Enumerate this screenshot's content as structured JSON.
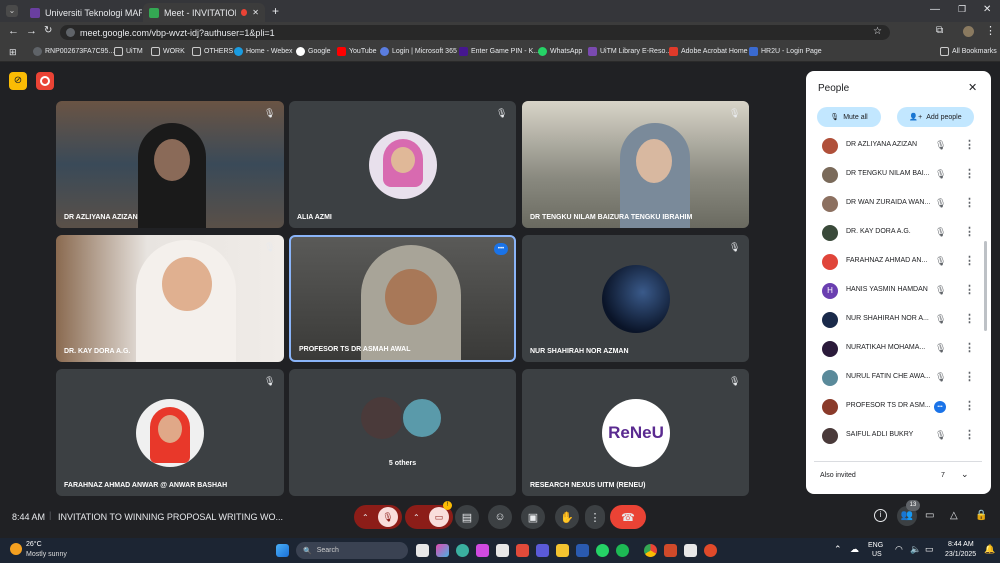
{
  "browser": {
    "tabs": [
      {
        "label": "Universiti Teknologi MARA - Ca",
        "active": false
      },
      {
        "label": "Meet - INVITATION TO WIN",
        "active": true
      }
    ],
    "new_tab": "+",
    "url": "meet.google.com/vbp-wvzt-idj?authuser=1&pli=1",
    "bookmarks": [
      "RNP002673FA7C95...",
      "UiTM",
      "WORK",
      "OTHERS",
      "Home - Webex",
      "Google",
      "YouTube",
      "Login | Microsoft 365",
      "Enter Game PIN - K...",
      "WhatsApp",
      "UiTM Library E-Reso...",
      "Adobe Acrobat Home",
      "HR2U - Login Page"
    ],
    "all_bookmarks": "All Bookmarks"
  },
  "tiles": [
    {
      "name": "DR AZLIYANA AZIZAN"
    },
    {
      "name": "ALIA AZMI"
    },
    {
      "name": "DR TENGKU NILAM BAIZURA TENGKU IBRAHIM"
    },
    {
      "name": "DR. KAY DORA A.G."
    },
    {
      "name": "PROFESOR TS DR ASMAH AWAL"
    },
    {
      "name": "NUR SHAHIRAH NOR AZMAN"
    },
    {
      "name": "FARAHNAZ AHMAD ANWAR @ ANWAR BASHAH"
    },
    {
      "name": "5 others"
    },
    {
      "name": "RESEARCH NEXUS UITM (RENEU)",
      "logo_text": "ReNeU"
    }
  ],
  "people_panel": {
    "title": "People",
    "mute_all": "Mute all",
    "add_people": "Add people",
    "participants": [
      {
        "name": "DR AZLIYANA AZIZAN",
        "color": "#b0503a"
      },
      {
        "name": "DR TENGKU NILAM BAI...",
        "color": "#7a6a5a"
      },
      {
        "name": "DR WAN ZURAIDA WAN...",
        "color": "#8c7060"
      },
      {
        "name": "DR. KAY DORA A.G.",
        "color": "#3a4a3a"
      },
      {
        "name": "FARAHNAZ AHMAD AN...",
        "color": "#e0453a"
      },
      {
        "name": "HANIS YASMIN HAMDAN",
        "color": "#6a3fb0",
        "initial": "H"
      },
      {
        "name": "NUR SHAHIRAH NOR A...",
        "color": "#1a2a4a"
      },
      {
        "name": "NURATIKAH MOHAMA...",
        "color": "#2a1a3a"
      },
      {
        "name": "NURUL FATIN CHE AWA...",
        "color": "#5a8a9a"
      },
      {
        "name": "PROFESOR TS DR ASM...",
        "color": "#8a3a2a"
      },
      {
        "name": "SAIFUL ADLI BUKRY",
        "color": "#4a3a3a"
      }
    ],
    "also_invited": "Also invited",
    "also_invited_count": "7"
  },
  "bottom_bar": {
    "time": "8:44 AM",
    "meeting_title": "INVITATION TO WINNING PROPOSAL WRITING WO...",
    "people_count": "13"
  },
  "taskbar": {
    "temp": "26°C",
    "weather": "Mostly sunny",
    "search": "Search",
    "lang": "ENG",
    "region": "US",
    "clock_time": "8:44 AM",
    "clock_date": "23/1/2025"
  },
  "colors": {
    "accent_red": "#ea4335",
    "meet_bg": "#202124",
    "tile_bg": "#3c4043",
    "pill_blue": "#c2e7ff"
  }
}
